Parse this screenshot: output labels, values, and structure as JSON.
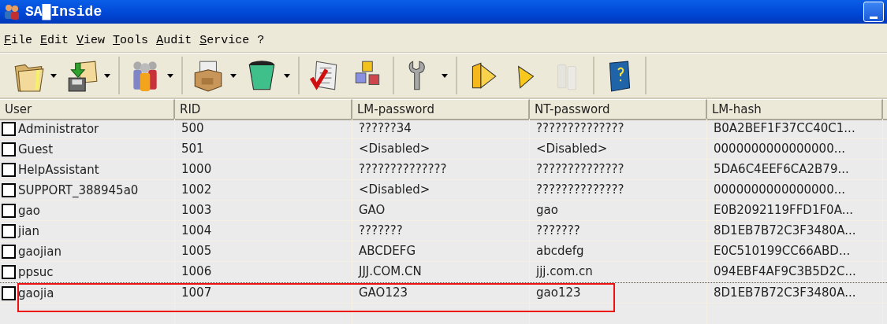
{
  "window": {
    "title": "SA█Inside"
  },
  "menu": [
    "File",
    "Edit",
    "View",
    "Tools",
    "Audit",
    "Service",
    "?"
  ],
  "toolbar": [
    [
      {
        "kind": "folder",
        "dropdown": true,
        "disabled": false
      },
      {
        "kind": "import",
        "dropdown": true,
        "disabled": false
      }
    ],
    [
      {
        "kind": "users",
        "dropdown": true,
        "disabled": false
      }
    ],
    [
      {
        "kind": "box",
        "dropdown": true,
        "disabled": false
      },
      {
        "kind": "bin",
        "dropdown": true,
        "disabled": false
      }
    ],
    [
      {
        "kind": "checklist",
        "dropdown": false,
        "disabled": false
      },
      {
        "kind": "cubes",
        "dropdown": false,
        "disabled": false
      }
    ],
    [
      {
        "kind": "wrench",
        "dropdown": true,
        "disabled": false
      }
    ],
    [
      {
        "kind": "prism",
        "dropdown": false,
        "disabled": false
      },
      {
        "kind": "triangle",
        "dropdown": false,
        "disabled": false
      },
      {
        "kind": "pause",
        "dropdown": false,
        "disabled": true
      }
    ],
    [
      {
        "kind": "book",
        "dropdown": false,
        "disabled": false
      }
    ]
  ],
  "table": {
    "columns": [
      "User",
      "RID",
      "LM-password",
      "NT-password",
      "LM-hash"
    ],
    "rows": [
      {
        "checked": false,
        "focused": false,
        "highlighted": false,
        "cells": [
          "Administrator",
          "500",
          "??????34",
          "??????????????",
          "B0A2BEF1F37CC40C1..."
        ]
      },
      {
        "checked": false,
        "focused": false,
        "highlighted": false,
        "cells": [
          "Guest",
          "501",
          "<Disabled>",
          "<Disabled>",
          "0000000000000000..."
        ]
      },
      {
        "checked": false,
        "focused": false,
        "highlighted": false,
        "cells": [
          "HelpAssistant",
          "1000",
          "??????????????",
          "??????????????",
          "5DA6C4EEF6CA2B79..."
        ]
      },
      {
        "checked": false,
        "focused": false,
        "highlighted": false,
        "cells": [
          "SUPPORT_388945a0",
          "1002",
          "<Disabled>",
          "??????????????",
          "0000000000000000..."
        ]
      },
      {
        "checked": false,
        "focused": false,
        "highlighted": false,
        "cells": [
          "gao",
          "1003",
          "GAO",
          "gao",
          "E0B2092119FFD1F0A..."
        ]
      },
      {
        "checked": false,
        "focused": false,
        "highlighted": false,
        "cells": [
          "jian",
          "1004",
          "???????",
          "???????",
          "8D1EB7B72C3F3480A..."
        ]
      },
      {
        "checked": false,
        "focused": false,
        "highlighted": false,
        "cells": [
          "gaojian",
          "1005",
          "ABCDEFG",
          "abcdefg",
          "E0C510199CC66ABD..."
        ]
      },
      {
        "checked": false,
        "focused": false,
        "highlighted": false,
        "cells": [
          "ppsuc",
          "1006",
          "JJJ.COM.CN",
          "jjj.com.cn",
          "094EBF4AF9C3B5D2C..."
        ]
      },
      {
        "checked": false,
        "focused": true,
        "highlighted": true,
        "cells": [
          "gaojia",
          "1007",
          "GAO123",
          "gao123",
          "8D1EB7B72C3F3480A..."
        ]
      }
    ]
  }
}
